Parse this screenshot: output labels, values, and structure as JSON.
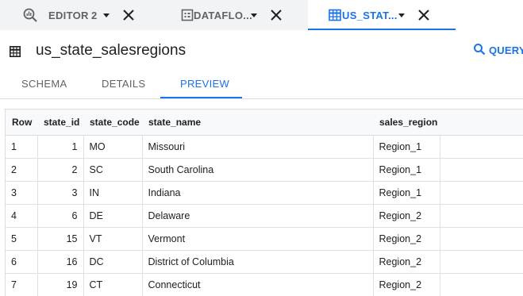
{
  "tabs": [
    {
      "label": "EDITOR",
      "count": "2",
      "icon": "query-search-icon"
    },
    {
      "label": "DATAFLO...",
      "icon": "dataflow-grid-icon"
    },
    {
      "label": "US_STAT...",
      "icon": "table-icon"
    }
  ],
  "header": {
    "title": "us_state_salesregions",
    "query_label": "QUERY"
  },
  "subtabs": [
    "SCHEMA",
    "DETAILS",
    "PREVIEW"
  ],
  "table": {
    "columns": [
      "Row",
      "state_id",
      "state_code",
      "state_name",
      "sales_region"
    ],
    "rows": [
      [
        "1",
        "1",
        "MO",
        "Missouri",
        "Region_1"
      ],
      [
        "2",
        "2",
        "SC",
        "South Carolina",
        "Region_1"
      ],
      [
        "3",
        "3",
        "IN",
        "Indiana",
        "Region_1"
      ],
      [
        "4",
        "6",
        "DE",
        "Delaware",
        "Region_2"
      ],
      [
        "5",
        "15",
        "VT",
        "Vermont",
        "Region_2"
      ],
      [
        "6",
        "16",
        "DC",
        "District of Columbia",
        "Region_2"
      ],
      [
        "7",
        "19",
        "CT",
        "Connecticut",
        "Region_2"
      ]
    ]
  },
  "colors": {
    "accent": "#1a73e8",
    "tab_bg": "#f1f3f4",
    "muted_text": "#5f6368"
  }
}
